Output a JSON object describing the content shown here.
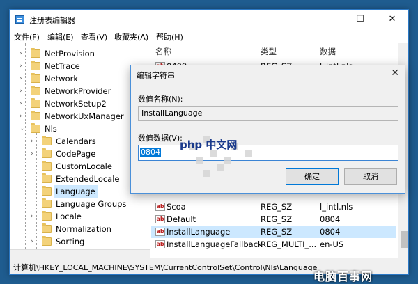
{
  "window": {
    "title": "注册表编辑器",
    "min": "—",
    "max": "☐",
    "close": "✕"
  },
  "menu": [
    "文件(F)",
    "编辑(E)",
    "查看(V)",
    "收藏夹(A)",
    "帮助(H)"
  ],
  "tree": [
    {
      "label": "NetProvision",
      "expander": "›",
      "indent": 1
    },
    {
      "label": "NetTrace",
      "expander": "›",
      "indent": 1
    },
    {
      "label": "Network",
      "expander": "›",
      "indent": 1
    },
    {
      "label": "NetworkProvider",
      "expander": "›",
      "indent": 1
    },
    {
      "label": "NetworkSetup2",
      "expander": "›",
      "indent": 1
    },
    {
      "label": "NetworkUxManager",
      "expander": "›",
      "indent": 1
    },
    {
      "label": "Nls",
      "expander": "⌄",
      "indent": 1
    },
    {
      "label": "Calendars",
      "expander": "›",
      "indent": 2
    },
    {
      "label": "CodePage",
      "expander": "›",
      "indent": 2
    },
    {
      "label": "CustomLocale",
      "expander": "",
      "indent": 2
    },
    {
      "label": "ExtendedLocale",
      "expander": "",
      "indent": 2
    },
    {
      "label": "Language",
      "expander": "",
      "indent": 2,
      "selected": true
    },
    {
      "label": "Language Groups",
      "expander": "",
      "indent": 2
    },
    {
      "label": "Locale",
      "expander": "›",
      "indent": 2
    },
    {
      "label": "Normalization",
      "expander": "",
      "indent": 2
    },
    {
      "label": "Sorting",
      "expander": "›",
      "indent": 2
    }
  ],
  "list": {
    "headers": [
      "名称",
      "类型",
      "数据"
    ],
    "rows": [
      {
        "name": "0409",
        "type": "REG_SZ",
        "data": "l_intl.nls"
      },
      {
        "name": "Scoa",
        "type": "REG_SZ",
        "data": "l_intl.nls"
      },
      {
        "name": "Default",
        "type": "REG_SZ",
        "data": "0804"
      },
      {
        "name": "InstallLanguage",
        "type": "REG_SZ",
        "data": "0804",
        "selected": true
      },
      {
        "name": "InstallLanguageFallback",
        "type": "REG_MULTI_...",
        "data": "en-US"
      }
    ]
  },
  "status": {
    "path": "计算机\\HKEY_LOCAL_MACHINE\\SYSTEM\\CurrentControlSet\\Control\\Nls\\Language"
  },
  "dialog": {
    "title": "编辑字符串",
    "close": "✕",
    "name_label": "数值名称(N):",
    "name_value": "InstallLanguage",
    "data_label": "数值数据(V):",
    "data_value": "0804",
    "ok": "确定",
    "cancel": "取消"
  },
  "watermark": {
    "php": "php 中文网",
    "brand": "电脑百事网"
  },
  "colors": {
    "selection": "#cce8ff",
    "accent": "#0078d7",
    "folder": "#f3d27a"
  }
}
